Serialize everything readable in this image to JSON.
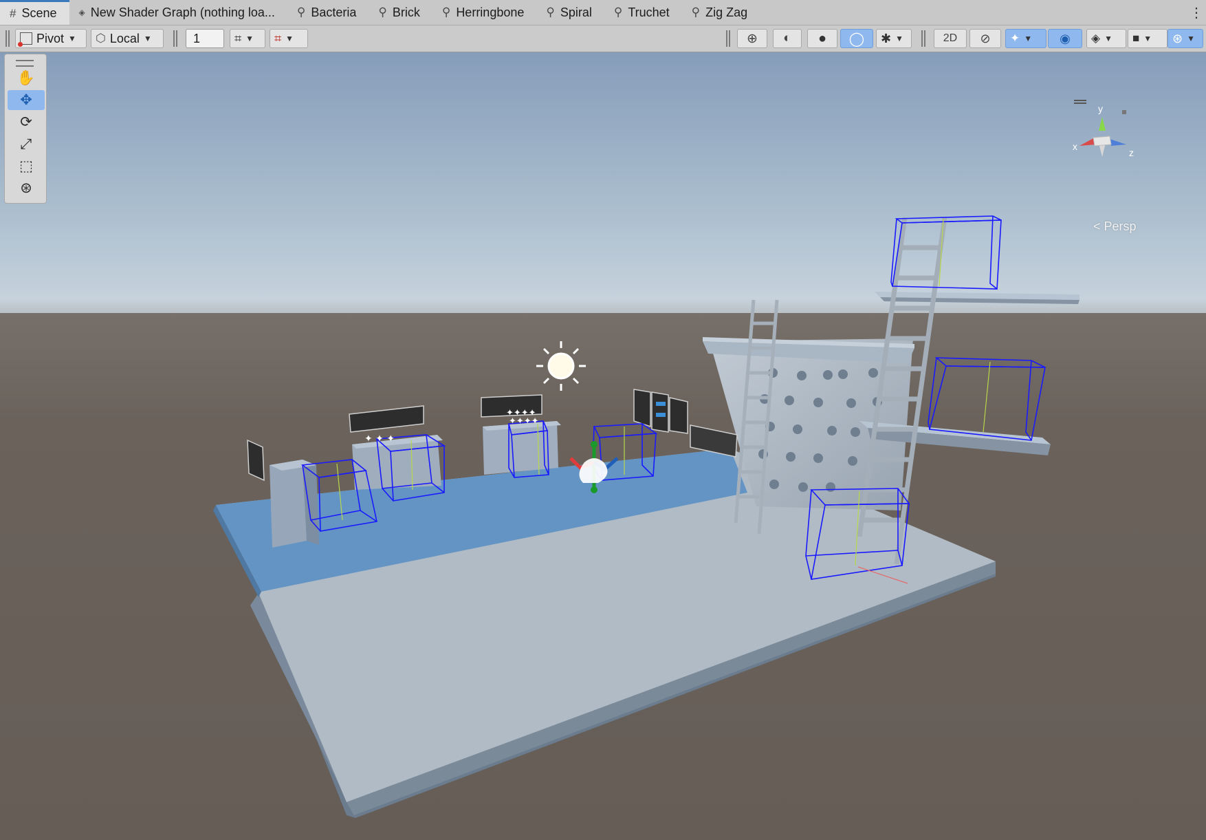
{
  "tabs": [
    {
      "label": "Scene",
      "icon": "grid-icon",
      "active": true
    },
    {
      "label": "New Shader Graph (nothing loa...",
      "icon": "shader-graph-icon",
      "active": false
    },
    {
      "label": "Bacteria",
      "icon": "shader-graph-icon",
      "active": false
    },
    {
      "label": "Brick",
      "icon": "shader-graph-icon",
      "active": false
    },
    {
      "label": "Herringbone",
      "icon": "shader-graph-icon",
      "active": false
    },
    {
      "label": "Spiral",
      "icon": "shader-graph-icon",
      "active": false
    },
    {
      "label": "Truchet",
      "icon": "shader-graph-icon",
      "active": false
    },
    {
      "label": "Zig Zag",
      "icon": "shader-graph-icon",
      "active": false
    }
  ],
  "toolbar": {
    "pivot_label": "Pivot",
    "local_label": "Local",
    "increment_value": "1"
  },
  "tools": [
    {
      "name": "hand-tool",
      "icon": "hand-icon",
      "active": false
    },
    {
      "name": "move-tool",
      "icon": "move-icon",
      "active": true
    },
    {
      "name": "rotate-tool",
      "icon": "rotate-icon",
      "active": false
    },
    {
      "name": "scale-tool",
      "icon": "scale-icon",
      "active": false
    },
    {
      "name": "rect-tool",
      "icon": "rect-icon",
      "active": false
    },
    {
      "name": "transform-tool",
      "icon": "transform-icon",
      "active": false
    }
  ],
  "gizmo": {
    "x_label": "x",
    "y_label": "y",
    "z_label": "z",
    "projection_label": "< Persp"
  },
  "colors": {
    "sky_top": "#8aa3c0",
    "horizon": "#c8d5df",
    "ground": "#686058",
    "floor_light": "#b2bcc6",
    "floor_blue": "#6394c4",
    "selection_blue": "#1a1aff",
    "active_tool": "#8fb8ee"
  }
}
